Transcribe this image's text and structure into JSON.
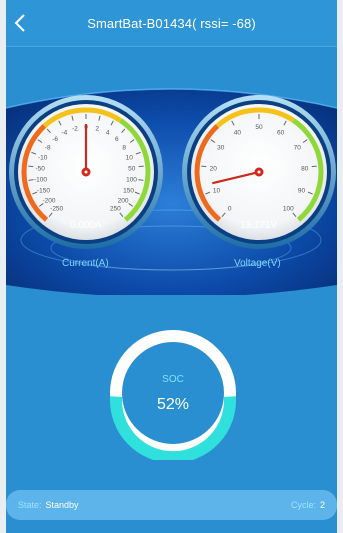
{
  "header": {
    "title": "SmartBat-B01434( rssi= -68)",
    "back_icon": "chevron-left-icon"
  },
  "gauges": {
    "current": {
      "label": "Current(A)",
      "readout": "0.000A",
      "ticks": [
        "-250",
        "-200",
        "-150",
        "-100",
        "-50",
        "-10",
        "-8",
        "-6",
        "-4",
        "-2",
        "0",
        "2",
        "4",
        "6",
        "8",
        "10",
        "50",
        "100",
        "150",
        "200",
        "250"
      ],
      "value": 0
    },
    "voltage": {
      "label": "Voltage(V)",
      "readout": "13.171V",
      "ticks": [
        "0",
        "10",
        "20",
        "30",
        "40",
        "50",
        "60",
        "70",
        "80",
        "90",
        "100"
      ],
      "value": 13.171
    }
  },
  "soc": {
    "label": "SOC",
    "value_text": "52%",
    "fraction": 0.52
  },
  "status": {
    "state_key": "State:",
    "state_value": "Standby",
    "cycle_key": "Cycle:",
    "cycle_value": "2"
  },
  "colors": {
    "background": "#2a8fd0",
    "soc_fill": "#2fe0dc",
    "soc_track": "#ffffff"
  }
}
